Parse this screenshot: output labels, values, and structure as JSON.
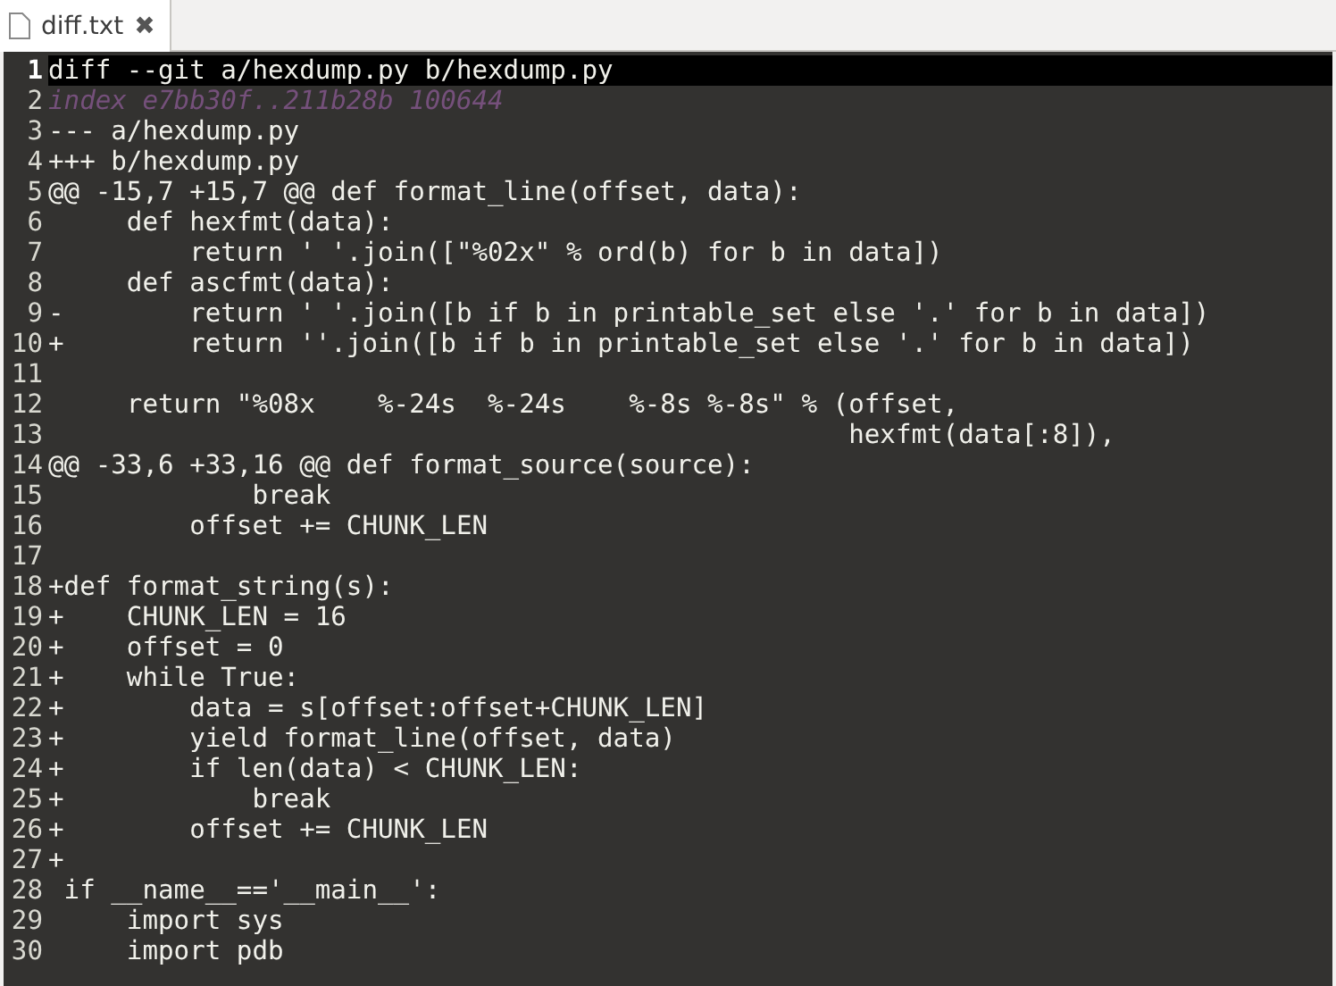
{
  "tabs": [
    {
      "label": "diff.txt",
      "close": "✖",
      "selected": true
    }
  ],
  "lines": [
    {
      "number": "1",
      "text": "diff --git a/hexdump.py b/hexdump.py",
      "kind": "header",
      "current": true
    },
    {
      "number": "2",
      "text": "index e7bb30f..211b28b 100644",
      "kind": "meta",
      "current": false
    },
    {
      "number": "3",
      "text": "--- a/hexdump.py",
      "kind": "plain",
      "current": false
    },
    {
      "number": "4",
      "text": "+++ b/hexdump.py",
      "kind": "plain",
      "current": false
    },
    {
      "number": "5",
      "text": "@@ -15,7 +15,7 @@ def format_line(offset, data):",
      "kind": "plain",
      "current": false
    },
    {
      "number": "6",
      "text": "     def hexfmt(data):",
      "kind": "plain",
      "current": false
    },
    {
      "number": "7",
      "text": "         return ' '.join([\"%02x\" % ord(b) for b in data])",
      "kind": "plain",
      "current": false
    },
    {
      "number": "8",
      "text": "     def ascfmt(data):",
      "kind": "plain",
      "current": false
    },
    {
      "number": "9",
      "text": "-        return ' '.join([b if b in printable_set else '.' for b in data])",
      "kind": "plain",
      "current": false
    },
    {
      "number": "10",
      "text": "+        return ''.join([b if b in printable_set else '.' for b in data])",
      "kind": "plain",
      "current": false
    },
    {
      "number": "11",
      "current": false
    },
    {
      "number": "12",
      "text": "     return \"%08x    %-24s  %-24s    %-8s %-8s\" % (offset,",
      "kind": "plain",
      "current": false
    },
    {
      "number": "13",
      "text": "                                                   hexfmt(data[:8]),",
      "kind": "plain",
      "current": false
    },
    {
      "number": "14",
      "text": "@@ -33,6 +33,16 @@ def format_source(source):",
      "kind": "plain",
      "current": false
    },
    {
      "number": "15",
      "text": "             break",
      "kind": "plain",
      "current": false
    },
    {
      "number": "16",
      "text": "         offset += CHUNK_LEN",
      "kind": "plain",
      "current": false
    },
    {
      "number": "17",
      "current": false
    },
    {
      "number": "18",
      "text": "+def format_string(s):",
      "kind": "plain",
      "current": false
    },
    {
      "number": "19",
      "text": "+    CHUNK_LEN = 16",
      "kind": "plain",
      "current": false
    },
    {
      "number": "20",
      "text": "+    offset = 0",
      "kind": "plain",
      "current": false
    },
    {
      "number": "21",
      "text": "+    while True:",
      "kind": "plain",
      "current": false
    },
    {
      "number": "22",
      "text": "+        data = s[offset:offset+CHUNK_LEN]",
      "kind": "plain",
      "current": false
    },
    {
      "number": "23",
      "text": "+        yield format_line(offset, data)",
      "kind": "plain",
      "current": false
    },
    {
      "number": "24",
      "text": "+        if len(data) < CHUNK_LEN:",
      "kind": "plain",
      "current": false
    },
    {
      "number": "25",
      "text": "+            break",
      "kind": "plain",
      "current": false
    },
    {
      "number": "26",
      "text": "+        offset += CHUNK_LEN",
      "kind": "plain",
      "current": false
    },
    {
      "number": "27",
      "text": "+",
      "kind": "plain",
      "current": false
    },
    {
      "number": "28",
      "text": " if __name__=='__main__':",
      "kind": "plain",
      "current": false
    },
    {
      "number": "29",
      "text": "     import sys",
      "kind": "plain",
      "current": false
    },
    {
      "number": "30",
      "text": "     import pdb",
      "kind": "plain",
      "current": false
    }
  ]
}
